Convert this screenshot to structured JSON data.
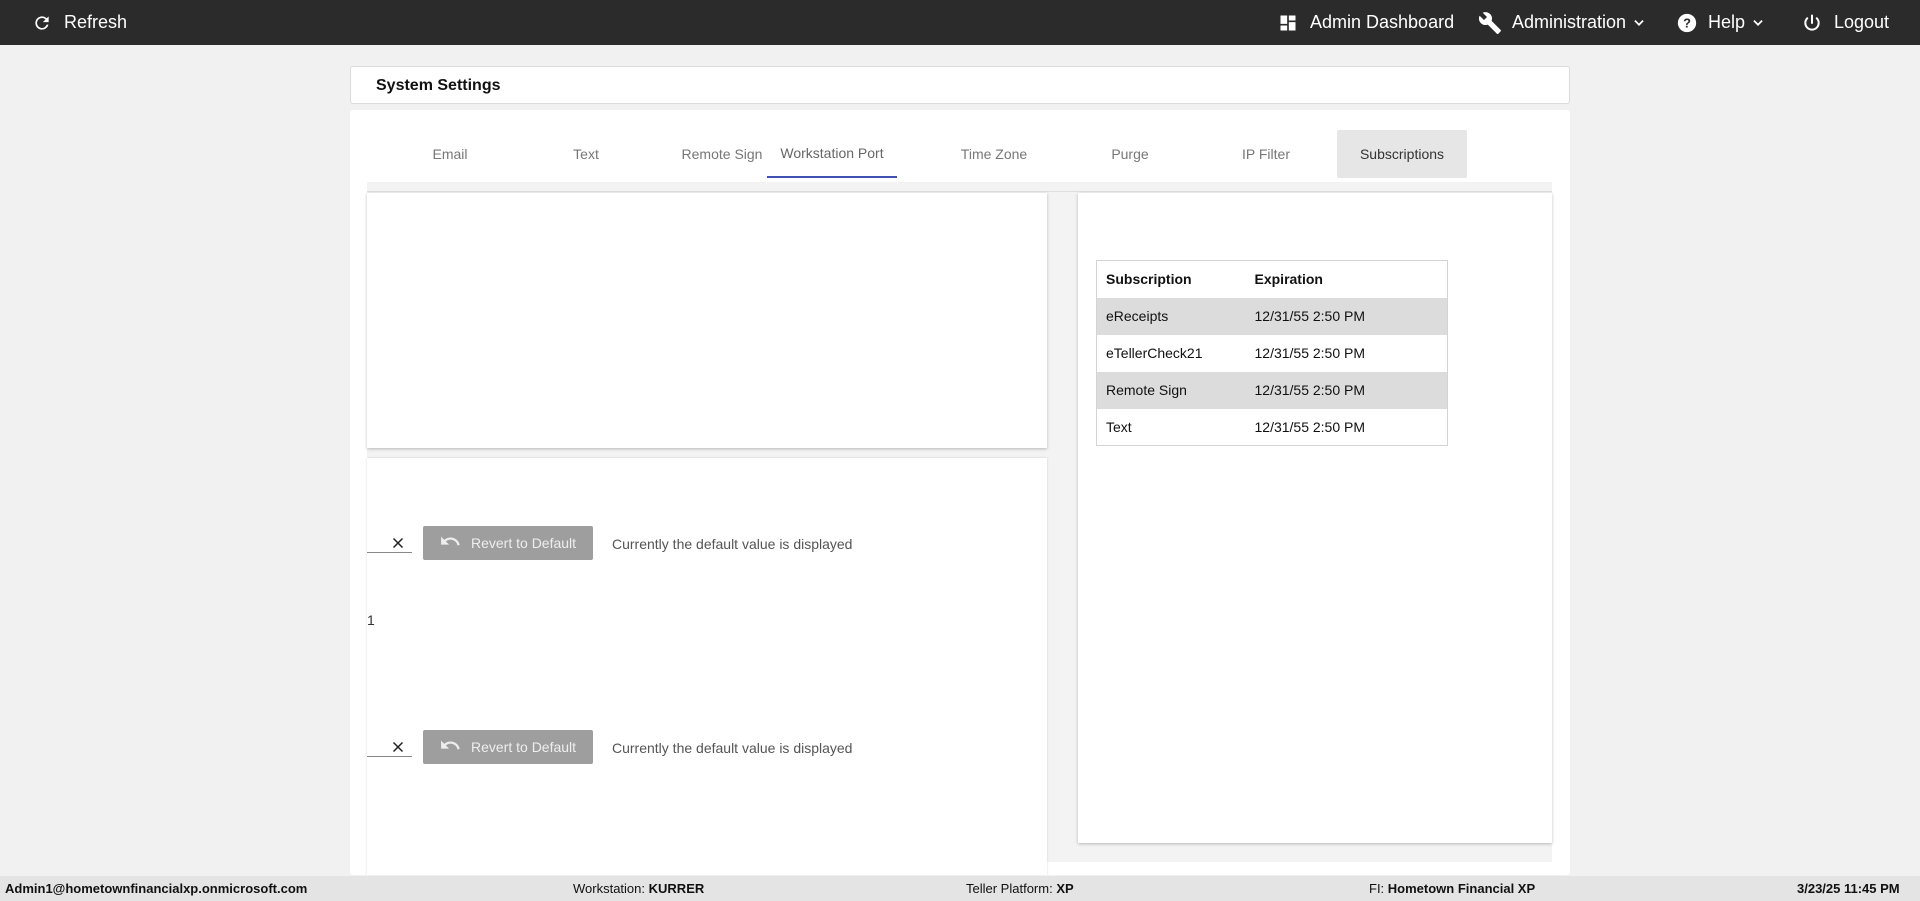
{
  "topbar": {
    "refresh_label": "Refresh",
    "admin_dashboard_label": "Admin Dashboard",
    "administration_label": "Administration",
    "help_label": "Help",
    "logout_label": "Logout",
    "icons": [
      "refresh-icon",
      "dashboard-icon",
      "wrench-icon",
      "help-circle-icon",
      "power-icon",
      "chevron-down-icon"
    ]
  },
  "page": {
    "title": "System Settings"
  },
  "tabs": [
    {
      "label": "Email"
    },
    {
      "label": "Text"
    },
    {
      "label": "Remote Sign"
    },
    {
      "label": "Workstation Port"
    },
    {
      "label": "Time Zone"
    },
    {
      "label": "Purge"
    },
    {
      "label": "IP Filter"
    },
    {
      "label": "Subscriptions"
    }
  ],
  "settings": {
    "rows": [
      {
        "revert_label": "Revert to Default",
        "note": "Currently the default value is displayed"
      },
      {
        "revert_label": "Revert to Default",
        "note": "Currently the default value is displayed"
      }
    ],
    "fragment_char": "1"
  },
  "subscriptions": {
    "headers": {
      "subscription": "Subscription",
      "expiration": "Expiration"
    },
    "rows": [
      {
        "subscription": "eReceipts",
        "expiration": "12/31/55 2:50 PM"
      },
      {
        "subscription": "eTellerCheck21",
        "expiration": "12/31/55 2:50 PM"
      },
      {
        "subscription": "Remote Sign",
        "expiration": "12/31/55 2:50 PM"
      },
      {
        "subscription": "Text",
        "expiration": "12/31/55 2:50 PM"
      }
    ]
  },
  "statusbar": {
    "user": "Admin1@hometownfinancialxp.onmicrosoft.com",
    "workstation_label": "Workstation:",
    "workstation_value": "KURRER",
    "platform_label": "Teller Platform:",
    "platform_value": "XP",
    "fi_label": "FI:",
    "fi_value": "Hometown Financial XP",
    "datetime": "3/23/25 11:45 PM"
  },
  "colors": {
    "topbar_bg": "#2b2b2b",
    "active_tab_underline": "#3f51b5",
    "revert_button_bg": "#9e9e9e",
    "alt_row_bg": "#dcdcdc"
  }
}
